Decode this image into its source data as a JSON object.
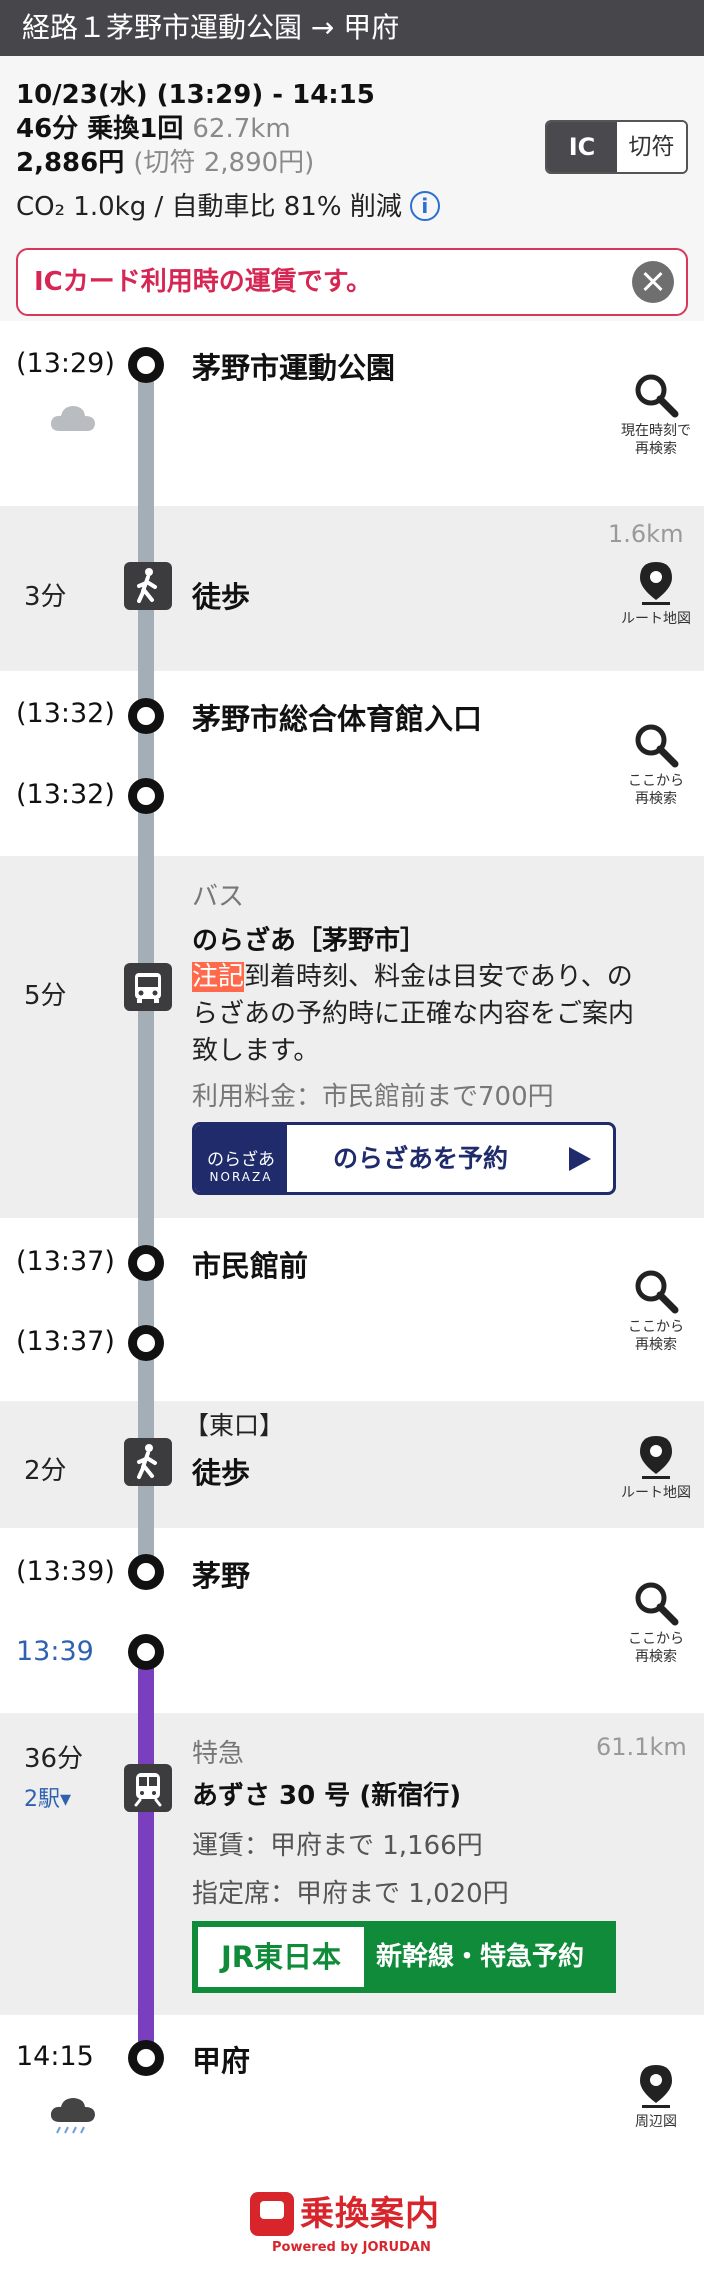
{
  "header": {
    "title": "経路１茅野市運動公園 → 甲府"
  },
  "summary": {
    "datetime": "10/23(水) (13:29) - 14:15",
    "duration_transfer": "46分 乗換1回",
    "distance": "62.7km",
    "fare": "2,886円",
    "fare_ticket": "(切符 2,890円)",
    "co2": "CO₂ 1.0kg / 自動車比 81% 削減",
    "info_icon": "i",
    "toggle_ic": "IC",
    "toggle_ticket": "切符",
    "notice": "ICカード利用時の運賃です。"
  },
  "route": {
    "s1": {
      "time": "(13:29)",
      "name": "茅野市運動公園",
      "btn": [
        "現在時刻で",
        "再検索"
      ]
    },
    "walk1": {
      "dur": "3分",
      "label": "徒歩",
      "distance": "1.6km",
      "btn": "ルート地図"
    },
    "s2": {
      "time_arr": "(13:32)",
      "name": "茅野市総合体育館入口",
      "time_dep": "(13:32)",
      "btn": [
        "ここから",
        "再検索"
      ]
    },
    "bus": {
      "dur": "5分",
      "type": "バス",
      "name": "のらざあ［茅野市］",
      "note_tag": "注記",
      "note_1": "到着時刻、料金は目安であり、の",
      "note_2": "らざあの予約時に正確な内容をご案内",
      "note_3": "致します。",
      "fare": "利用料金：市民館前まで700円",
      "reserve_logo_1": "のらざあ",
      "reserve_logo_2": "NORAZA",
      "reserve_label": "のらざあを予約"
    },
    "s3": {
      "time_arr": "(13:37)",
      "name": "市民館前",
      "time_dep": "(13:37)",
      "btn": [
        "ここから",
        "再検索"
      ]
    },
    "walk2": {
      "exit": "【東口】",
      "dur": "2分",
      "label": "徒歩",
      "btn": "ルート地図"
    },
    "s4": {
      "time_arr": "(13:39)",
      "name": "茅野",
      "time_dep": "13:39",
      "btn": [
        "ここから",
        "再検索"
      ]
    },
    "train": {
      "dur": "36分",
      "stops": "2駅▾",
      "type": "特急",
      "distance": "61.1km",
      "name": "あずさ 30 号 (新宿行)",
      "fare": "運賃：甲府まで 1,166円",
      "reserved": "指定席：甲府まで 1,020円",
      "jr_logo": "JR東日本",
      "jr_label": "新幹線・特急予約"
    },
    "s5": {
      "time": "14:15",
      "name": "甲府",
      "btn": "周辺図"
    }
  },
  "footer": {
    "brand": "乗換案内",
    "powered": "Powered by JORUDAN"
  },
  "colors": {
    "header_bg": "#47474b",
    "rail_gray": "#a3aeb7",
    "rail_purple": "#7a3fbf",
    "notice_red": "#d62654",
    "jr_green": "#0f8b3a",
    "noraza_navy": "#1f2b6b",
    "brand_red": "#d8252c"
  }
}
